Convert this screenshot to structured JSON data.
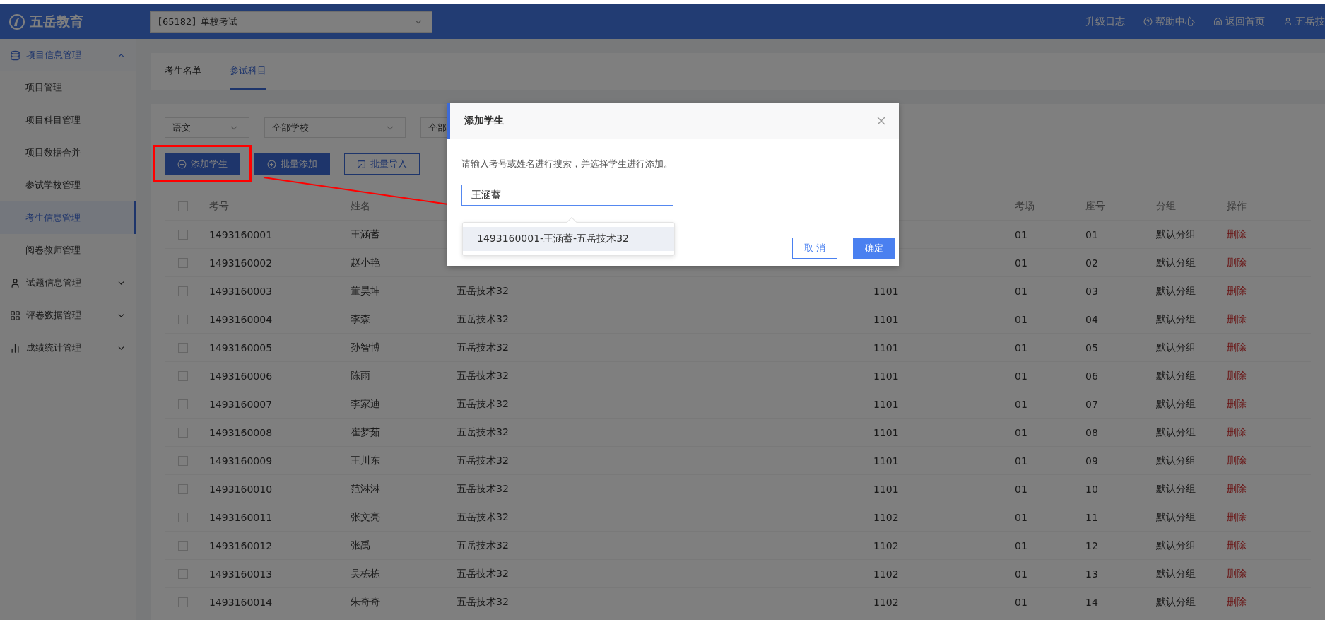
{
  "top_bar": {
    "logo": "五岳教育",
    "project_select": "【65182】单校考试",
    "links": [
      {
        "label": "升级日志"
      },
      {
        "label": "帮助中心"
      },
      {
        "label": "返回首页"
      },
      {
        "label": "五岳技"
      }
    ]
  },
  "sidebar": {
    "items": [
      {
        "label": "项目信息管理",
        "expanded": true,
        "children": [
          {
            "label": "项目管理",
            "selected": false
          },
          {
            "label": "项目科目管理",
            "selected": false
          },
          {
            "label": "项目数据合并",
            "selected": false
          },
          {
            "label": "参试学校管理",
            "selected": false
          },
          {
            "label": "考生信息管理",
            "selected": true
          },
          {
            "label": "阅卷教师管理",
            "selected": false
          }
        ]
      },
      {
        "label": "试题信息管理",
        "expanded": false
      },
      {
        "label": "评卷数据管理",
        "expanded": false
      },
      {
        "label": "成绩统计管理",
        "expanded": false
      }
    ]
  },
  "tabs": [
    {
      "label": "考生名单",
      "selected": false
    },
    {
      "label": "参试科目",
      "selected": true
    }
  ],
  "filters": [
    {
      "value": "语文"
    },
    {
      "value": "全部学校"
    },
    {
      "value": "全部"
    }
  ],
  "actions": [
    {
      "label": "添加学生",
      "kind": "primary"
    },
    {
      "label": "批量添加",
      "kind": "primary"
    },
    {
      "label": "批量导入",
      "kind": "outline"
    }
  ],
  "table": {
    "header": {
      "checked": false,
      "id": "考号",
      "name": "姓名",
      "room": "考场",
      "seat": "座号",
      "group": "分组",
      "action": "操作"
    },
    "rows": [
      {
        "checked": false,
        "id": "1493160001",
        "name": "王涵蓄",
        "room": "01",
        "seat": "01",
        "group": "默认分组",
        "action": "删除"
      },
      {
        "checked": false,
        "id": "1493160002",
        "name": "赵小艳",
        "room": "01",
        "seat": "02",
        "group": "默认分组",
        "action": "删除"
      },
      {
        "checked": false,
        "id": "1493160003",
        "name": "董昊坤",
        "column_3": "五岳技术32",
        "column_4": "1101",
        "room": "01",
        "seat": "03",
        "group": "默认分组",
        "action": "删除"
      },
      {
        "checked": false,
        "id": "1493160004",
        "name": "李森",
        "column_3": "五岳技术32",
        "column_4": "1101",
        "room": "01",
        "seat": "04",
        "group": "默认分组",
        "action": "删除"
      },
      {
        "checked": false,
        "id": "1493160005",
        "name": "孙智博",
        "column_3": "五岳技术32",
        "column_4": "1101",
        "room": "01",
        "seat": "05",
        "group": "默认分组",
        "action": "删除"
      },
      {
        "checked": false,
        "id": "1493160006",
        "name": "陈雨",
        "column_3": "五岳技术32",
        "column_4": "1101",
        "room": "01",
        "seat": "06",
        "group": "默认分组",
        "action": "删除"
      },
      {
        "checked": false,
        "id": "1493160007",
        "name": "李家迪",
        "column_3": "五岳技术32",
        "column_4": "1101",
        "room": "01",
        "seat": "07",
        "group": "默认分组",
        "action": "删除"
      },
      {
        "checked": false,
        "id": "1493160008",
        "name": "崔梦茹",
        "column_3": "五岳技术32",
        "column_4": "1101",
        "room": "01",
        "seat": "08",
        "group": "默认分组",
        "action": "删除"
      },
      {
        "checked": false,
        "id": "1493160009",
        "name": "王川东",
        "column_3": "五岳技术32",
        "column_4": "1101",
        "room": "01",
        "seat": "09",
        "group": "默认分组",
        "action": "删除"
      },
      {
        "checked": false,
        "id": "1493160010",
        "name": "范淋淋",
        "column_3": "五岳技术32",
        "column_4": "1101",
        "room": "01",
        "seat": "10",
        "group": "默认分组",
        "action": "删除"
      },
      {
        "checked": false,
        "id": "1493160011",
        "name": "张文亮",
        "column_3": "五岳技术32",
        "column_4": "1102",
        "room": "01",
        "seat": "11",
        "group": "默认分组",
        "action": "删除"
      },
      {
        "checked": false,
        "id": "1493160012",
        "name": "张禹",
        "column_3": "五岳技术32",
        "column_4": "1102",
        "room": "01",
        "seat": "12",
        "group": "默认分组",
        "action": "删除"
      },
      {
        "checked": false,
        "id": "1493160013",
        "name": "吴栋栋",
        "column_3": "五岳技术32",
        "column_4": "1102",
        "room": "01",
        "seat": "13",
        "group": "默认分组",
        "action": "删除"
      },
      {
        "checked": false,
        "id": "1493160014",
        "name": "朱奇奇",
        "column_3": "五岳技术32",
        "column_4": "1102",
        "room": "01",
        "seat": "14",
        "group": "默认分组",
        "action": "删除"
      }
    ]
  },
  "dialog": {
    "title": "添加学生",
    "hint": "请输入考号或姓名进行搜索，并选择学生进行添加。",
    "search_value": "王涵蓄",
    "suggestions": [
      {
        "label": "1493160001-王涵蓄-五岳技术32",
        "selected": true
      }
    ],
    "buttons": [
      {
        "label": "取 消",
        "kind": "outline"
      },
      {
        "label": "确定",
        "kind": "primary"
      }
    ]
  }
}
